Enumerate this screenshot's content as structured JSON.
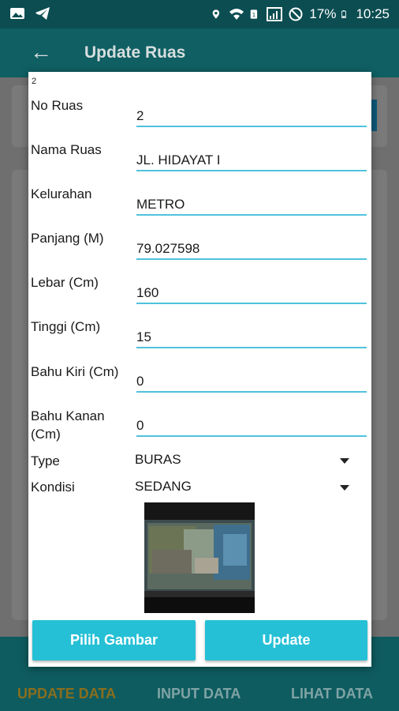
{
  "status_bar": {
    "battery": "17%",
    "time": "10:25",
    "icons": [
      "image-icon",
      "telegram-icon",
      "location-icon",
      "wifi-icon",
      "sim-icon",
      "signal-icon",
      "no-disturb-icon",
      "battery-icon"
    ]
  },
  "app_bar": {
    "title": "Update Ruas"
  },
  "dialog": {
    "id_label": "2",
    "fields": {
      "no_ruas": {
        "label": "No Ruas",
        "value": "2"
      },
      "nama_ruas": {
        "label": "Nama Ruas",
        "value": "JL. HIDAYAT I"
      },
      "kelurahan": {
        "label": "Kelurahan",
        "value": "METRO"
      },
      "panjang": {
        "label": "Panjang (M)",
        "value": "79.027598"
      },
      "lebar": {
        "label": "Lebar (Cm)",
        "value": "160"
      },
      "tinggi": {
        "label": "Tinggi (Cm)",
        "value": "15"
      },
      "bahu_kiri": {
        "label": "Bahu Kiri (Cm)",
        "value": "0"
      },
      "bahu_kanan": {
        "label": "Bahu Kanan (Cm)",
        "value": "0"
      }
    },
    "type": {
      "label": "Type",
      "selected": "BURAS"
    },
    "kondisi": {
      "label": "Kondisi",
      "selected": "SEDANG"
    },
    "buttons": {
      "pilih_gambar": "Pilih Gambar",
      "update": "Update"
    }
  },
  "bottom_nav": {
    "items": [
      {
        "label": "UPDATE DATA",
        "active": true
      },
      {
        "label": "INPUT DATA",
        "active": false
      },
      {
        "label": "LIHAT DATA",
        "active": false
      }
    ]
  },
  "colors": {
    "status_bar": "#0b4d51",
    "accent": "#25c0d6",
    "input_underline": "#50c2dd",
    "active_nav": "#8a6e1d"
  }
}
